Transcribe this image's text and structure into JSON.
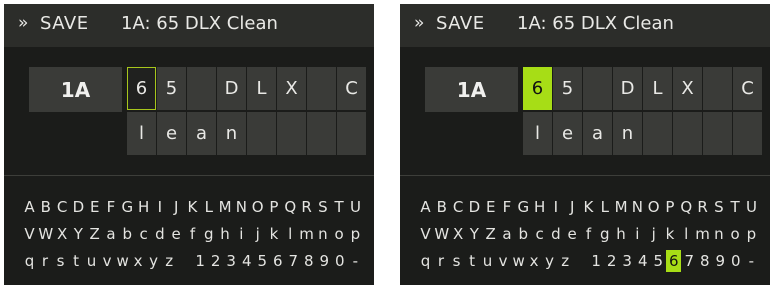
{
  "header": {
    "save_label": "SAVE",
    "preset_title": "1A: 65 DLX Clean",
    "chevron_glyph": "»"
  },
  "preset_slot": "1A",
  "cells": [
    "6",
    "5",
    "",
    "D",
    "L",
    "X",
    "",
    "C",
    "l",
    "e",
    "a",
    "n",
    "",
    "",
    "",
    ""
  ],
  "keyboard_rows": [
    [
      "A",
      "B",
      "C",
      "D",
      "E",
      "F",
      "G",
      "H",
      "I",
      "J",
      "K",
      "L",
      "M",
      "N",
      "O",
      "P",
      "Q",
      "R",
      "S",
      "T",
      "U"
    ],
    [
      "V",
      "W",
      "X",
      "Y",
      "Z",
      "a",
      "b",
      "c",
      "d",
      "e",
      "f",
      "g",
      "h",
      "i",
      "j",
      "k",
      "l",
      "m",
      "n",
      "o",
      "p"
    ],
    [
      "q",
      "r",
      "s",
      "t",
      "u",
      "v",
      "w",
      "x",
      "y",
      "z",
      "",
      "1",
      "2",
      "3",
      "4",
      "5",
      "6",
      "7",
      "8",
      "9",
      "0",
      "-"
    ]
  ],
  "screens": [
    {
      "cursor_cell": 0,
      "cursor_style": "outline",
      "selected_key": null
    },
    {
      "cursor_cell": 0,
      "cursor_style": "filled",
      "selected_key": {
        "row": 2,
        "index": 16
      }
    }
  ],
  "colors": {
    "accent": "#a7dd16",
    "background": "#1b1c1a",
    "header": "#2c2d2a",
    "cell": "#3a3b38"
  }
}
